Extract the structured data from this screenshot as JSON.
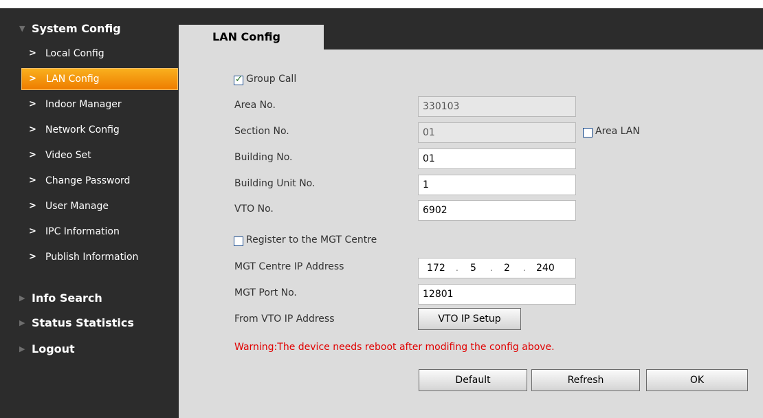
{
  "sidebar": {
    "sections": [
      {
        "label": "System Config",
        "icon": "triangle-down-icon"
      },
      {
        "label": "Info Search",
        "icon": "triangle-right-icon"
      },
      {
        "label": "Status Statistics",
        "icon": "triangle-right-icon"
      },
      {
        "label": "Logout",
        "icon": "triangle-right-icon"
      }
    ],
    "items": [
      {
        "label": "Local Config"
      },
      {
        "label": "LAN Config"
      },
      {
        "label": "Indoor Manager"
      },
      {
        "label": "Network Config"
      },
      {
        "label": "Video Set"
      },
      {
        "label": "Change Password"
      },
      {
        "label": "User Manage"
      },
      {
        "label": "IPC Information"
      },
      {
        "label": "Publish Information"
      }
    ],
    "active_item": "LAN Config",
    "item_icon": "chevron-right-icon"
  },
  "tab": {
    "title": "LAN Config"
  },
  "form": {
    "group_call": {
      "label": "Group Call",
      "checked": true
    },
    "area_no": {
      "label": "Area No.",
      "value": "330103",
      "disabled": true
    },
    "section_no": {
      "label": "Section No.",
      "value": "01",
      "disabled": true
    },
    "area_lan": {
      "label": "Area LAN",
      "checked": false
    },
    "building_no": {
      "label": "Building No.",
      "value": "01"
    },
    "building_unit_no": {
      "label": "Building Unit No.",
      "value": "1"
    },
    "vto_no": {
      "label": "VTO No.",
      "value": "6902"
    },
    "register_mgt": {
      "label": "Register to the MGT Centre",
      "checked": false
    },
    "mgt_ip": {
      "label": "MGT Centre IP Address",
      "octets": [
        "172",
        "5",
        "2",
        "240"
      ]
    },
    "mgt_port": {
      "label": "MGT Port No.",
      "value": "12801"
    },
    "from_vto_ip": {
      "label": "From VTO IP Address",
      "button": "VTO IP Setup"
    }
  },
  "warning": "Warning:The device needs reboot after modifing the config above.",
  "buttons": {
    "default": "Default",
    "refresh": "Refresh",
    "ok": "OK"
  },
  "colors": {
    "active_item": "#f29000",
    "warning": "#e00000",
    "sidebar_bg": "#2c2c2c",
    "content_bg": "#dcdcdc"
  }
}
